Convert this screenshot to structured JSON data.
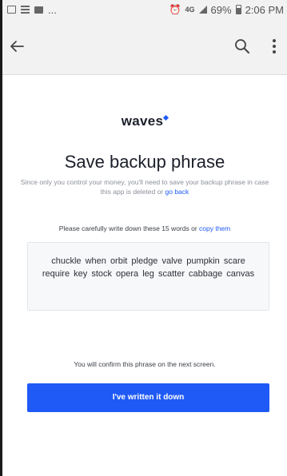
{
  "status_bar": {
    "left_ellipsis": "...",
    "network": "4G",
    "battery": "69%",
    "time": "2:06 PM",
    "icons": [
      "picture-icon",
      "list-icon",
      "video-icon",
      "alarm-icon",
      "signal-icon",
      "battery-icon"
    ]
  },
  "app_bar": {
    "icons": [
      "back-arrow-icon",
      "search-icon",
      "more-vert-icon"
    ]
  },
  "logo": {
    "text": "waves"
  },
  "title": "Save backup phrase",
  "subtitle": {
    "text": "Since only you control your money, you'll need to save your backup phrase in case this app is deleted or",
    "link": "go back"
  },
  "instruction": {
    "text": "Please carefully write down these 15 words  or",
    "link": "copy them"
  },
  "phrase": "chuckle  when  orbit  pledge  valve  pumpkin  scare  require  key  stock  opera  leg  scatter  cabbage  canvas",
  "confirm_text": "You will confirm this phrase on the next screen.",
  "primary_button": {
    "label": "I've written it down"
  },
  "colors": {
    "accent": "#1f5af6",
    "app_bar_bg": "#f2f2f2",
    "phrase_box_bg": "#f7f8fa"
  }
}
